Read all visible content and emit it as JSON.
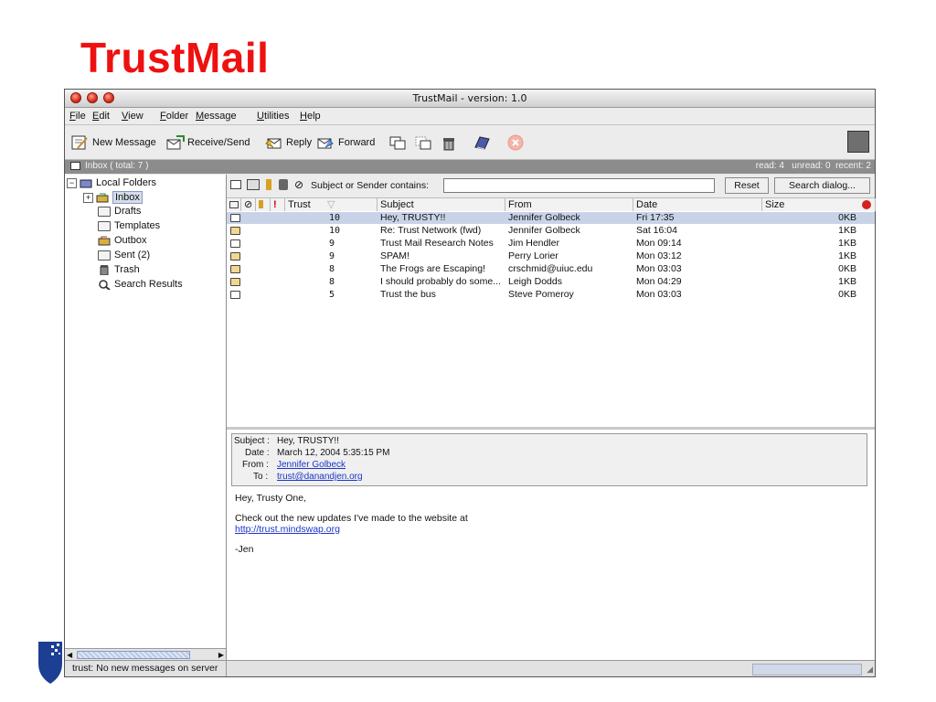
{
  "slide": {
    "title": "TrustMail",
    "title_color": "#ee1111"
  },
  "window": {
    "title": "TrustMail - version: 1.0"
  },
  "menu": [
    "File",
    "Edit",
    "View",
    "Folder",
    "Message",
    "Utilities",
    "Help"
  ],
  "toolbar": {
    "new_message": "New Message",
    "receive_send": "Receive/Send",
    "reply": "Reply",
    "forward": "Forward"
  },
  "folderbar": {
    "current": "Inbox ( total: 7 )",
    "counts": "read: 4   unread: 0  recent: 2"
  },
  "tree": {
    "root": "Local Folders",
    "items": [
      "Inbox",
      "Drafts",
      "Templates",
      "Outbox",
      "Sent (2)",
      "Trash",
      "Search Results"
    ]
  },
  "filter": {
    "label": "Subject or Sender contains:",
    "value": "",
    "reset": "Reset",
    "search_dialog": "Search dialog..."
  },
  "columns": {
    "trust": "Trust",
    "subject": "Subject",
    "from": "From",
    "date": "Date",
    "size": "Size"
  },
  "messages": [
    {
      "trust": "10",
      "subject": "Hey, TRUSTY!!",
      "from": "Jennifer Golbeck",
      "date": "Fri 17:35",
      "size": "0KB",
      "selected": true
    },
    {
      "trust": "10",
      "subject": "Re: Trust Network (fwd)",
      "from": "Jennifer Golbeck",
      "date": "Sat 16:04",
      "size": "1KB"
    },
    {
      "trust": "9",
      "subject": "Trust Mail Research Notes",
      "from": "Jim Hendler",
      "date": "Mon 09:14",
      "size": "1KB"
    },
    {
      "trust": "9",
      "subject": "SPAM!",
      "from": "Perry Lorier",
      "date": "Mon 03:12",
      "size": "1KB"
    },
    {
      "trust": "8",
      "subject": "The Frogs are Escaping!",
      "from": "crschmid@uiuc.edu",
      "date": "Mon 03:03",
      "size": "0KB"
    },
    {
      "trust": "8",
      "subject": "I should probably do some...",
      "from": "Leigh Dodds",
      "date": "Mon 04:29",
      "size": "1KB"
    },
    {
      "trust": "5",
      "subject": "Trust the bus",
      "from": "Steve Pomeroy",
      "date": "Mon 03:03",
      "size": "0KB"
    }
  ],
  "preview": {
    "subject_label": "Subject :",
    "subject": "Hey, TRUSTY!!",
    "date_label": "Date :",
    "date": "March 12, 2004 5:35:15 PM",
    "from_label": "From :",
    "from": "Jennifer Golbeck",
    "to_label": "To :",
    "to": "trust@danandjen.org",
    "body_line1": "Hey, Trusty One,",
    "body_line2": "Check out the new updates I've made to the website at",
    "body_link": "http://trust.mindswap.org",
    "body_sign": "-Jen"
  },
  "status": {
    "text": "trust: No new messages on server"
  }
}
